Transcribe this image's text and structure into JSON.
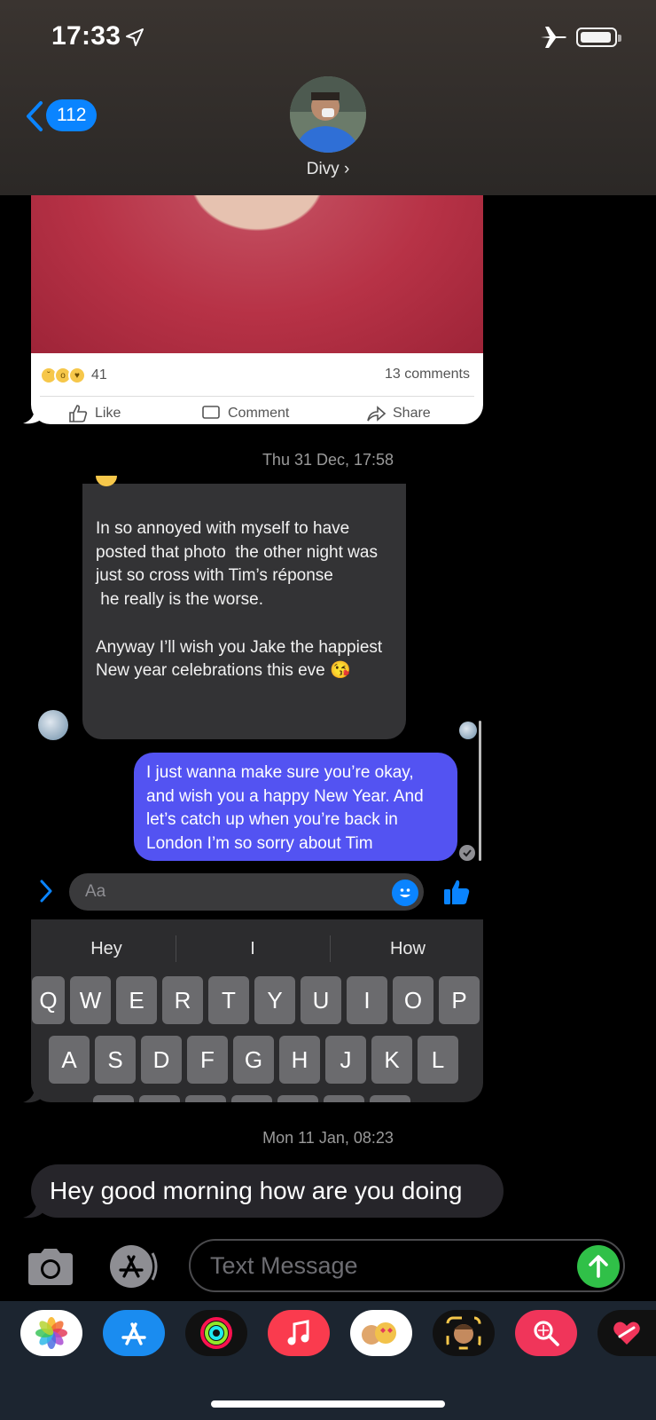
{
  "status_bar": {
    "time": "17:33",
    "icons": [
      "location-arrow-icon",
      "airplane-icon",
      "battery-icon"
    ]
  },
  "header": {
    "back_count": "112",
    "contact_name": "Divy ›"
  },
  "shared_post": {
    "reaction_icons": [
      "sad-reaction-icon",
      "wow-reaction-icon",
      "care-reaction-icon"
    ],
    "reaction_count": "41",
    "comments": "13 comments",
    "actions": [
      "Like",
      "Comment",
      "Share"
    ]
  },
  "timestamps": {
    "first": "Thu 31 Dec, 17:58",
    "second": "Mon 11 Jan, 08:23"
  },
  "incoming_message": "In so annoyed with myself to have posted that photo  the other night was just so cross with Tim’s réponse\n he really is the worse.\n\nAnyway I’ll wish you Jake the happiest New year celebrations this eve 😘",
  "outgoing_message": "I just wanna make sure you’re okay, and wish you a happy New Year. And let’s catch up when you’re back in London I’m so sorry about Tim",
  "messenger_input": {
    "placeholder": "Aa"
  },
  "keyboard": {
    "suggestions": [
      "Hey",
      "I",
      "How"
    ],
    "row1": [
      "Q",
      "W",
      "E",
      "R",
      "T",
      "Y",
      "U",
      "I",
      "O",
      "P"
    ],
    "row2": [
      "A",
      "S",
      "D",
      "F",
      "G",
      "H",
      "J",
      "K",
      "L"
    ]
  },
  "latest_message": "Hey good morning how are you doing",
  "imessage_input": {
    "placeholder": "Text Message"
  },
  "app_drawer": [
    "photos-app-icon",
    "app-store-icon",
    "activity-icon",
    "music-icon",
    "memoji-stickers-icon",
    "animoji-icon",
    "search-images-icon",
    "digital-touch-icon"
  ],
  "colors": {
    "outgoing_bubble": "#5353f2",
    "imessage_blue": "#0a84ff",
    "send_green": "#30c048",
    "card_red": "#b73246"
  }
}
